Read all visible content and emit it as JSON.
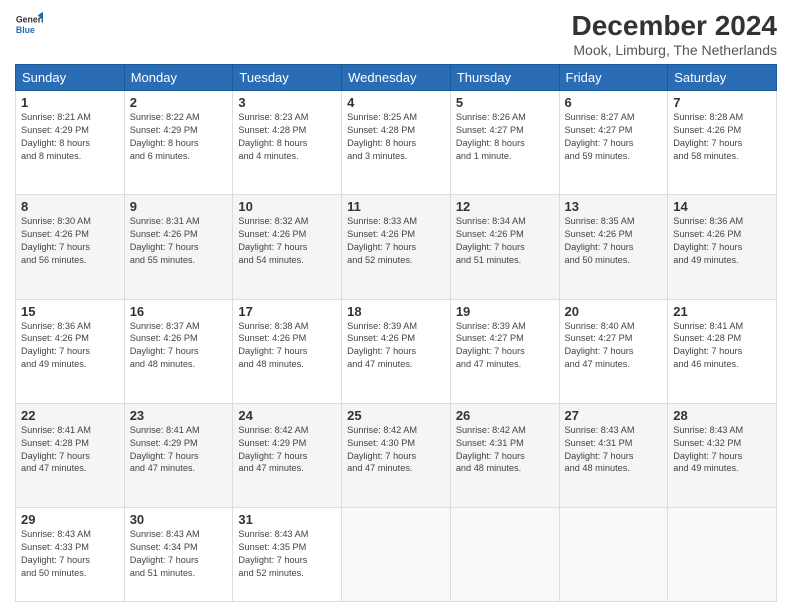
{
  "header": {
    "logo_line1": "General",
    "logo_line2": "Blue",
    "main_title": "December 2024",
    "subtitle": "Mook, Limburg, The Netherlands"
  },
  "days_of_week": [
    "Sunday",
    "Monday",
    "Tuesday",
    "Wednesday",
    "Thursday",
    "Friday",
    "Saturday"
  ],
  "weeks": [
    [
      {
        "day": "1",
        "text": "Sunrise: 8:21 AM\nSunset: 4:29 PM\nDaylight: 8 hours\nand 8 minutes."
      },
      {
        "day": "2",
        "text": "Sunrise: 8:22 AM\nSunset: 4:29 PM\nDaylight: 8 hours\nand 6 minutes."
      },
      {
        "day": "3",
        "text": "Sunrise: 8:23 AM\nSunset: 4:28 PM\nDaylight: 8 hours\nand 4 minutes."
      },
      {
        "day": "4",
        "text": "Sunrise: 8:25 AM\nSunset: 4:28 PM\nDaylight: 8 hours\nand 3 minutes."
      },
      {
        "day": "5",
        "text": "Sunrise: 8:26 AM\nSunset: 4:27 PM\nDaylight: 8 hours\nand 1 minute."
      },
      {
        "day": "6",
        "text": "Sunrise: 8:27 AM\nSunset: 4:27 PM\nDaylight: 7 hours\nand 59 minutes."
      },
      {
        "day": "7",
        "text": "Sunrise: 8:28 AM\nSunset: 4:26 PM\nDaylight: 7 hours\nand 58 minutes."
      }
    ],
    [
      {
        "day": "8",
        "text": "Sunrise: 8:30 AM\nSunset: 4:26 PM\nDaylight: 7 hours\nand 56 minutes."
      },
      {
        "day": "9",
        "text": "Sunrise: 8:31 AM\nSunset: 4:26 PM\nDaylight: 7 hours\nand 55 minutes."
      },
      {
        "day": "10",
        "text": "Sunrise: 8:32 AM\nSunset: 4:26 PM\nDaylight: 7 hours\nand 54 minutes."
      },
      {
        "day": "11",
        "text": "Sunrise: 8:33 AM\nSunset: 4:26 PM\nDaylight: 7 hours\nand 52 minutes."
      },
      {
        "day": "12",
        "text": "Sunrise: 8:34 AM\nSunset: 4:26 PM\nDaylight: 7 hours\nand 51 minutes."
      },
      {
        "day": "13",
        "text": "Sunrise: 8:35 AM\nSunset: 4:26 PM\nDaylight: 7 hours\nand 50 minutes."
      },
      {
        "day": "14",
        "text": "Sunrise: 8:36 AM\nSunset: 4:26 PM\nDaylight: 7 hours\nand 49 minutes."
      }
    ],
    [
      {
        "day": "15",
        "text": "Sunrise: 8:36 AM\nSunset: 4:26 PM\nDaylight: 7 hours\nand 49 minutes."
      },
      {
        "day": "16",
        "text": "Sunrise: 8:37 AM\nSunset: 4:26 PM\nDaylight: 7 hours\nand 48 minutes."
      },
      {
        "day": "17",
        "text": "Sunrise: 8:38 AM\nSunset: 4:26 PM\nDaylight: 7 hours\nand 48 minutes."
      },
      {
        "day": "18",
        "text": "Sunrise: 8:39 AM\nSunset: 4:26 PM\nDaylight: 7 hours\nand 47 minutes."
      },
      {
        "day": "19",
        "text": "Sunrise: 8:39 AM\nSunset: 4:27 PM\nDaylight: 7 hours\nand 47 minutes."
      },
      {
        "day": "20",
        "text": "Sunrise: 8:40 AM\nSunset: 4:27 PM\nDaylight: 7 hours\nand 47 minutes."
      },
      {
        "day": "21",
        "text": "Sunrise: 8:41 AM\nSunset: 4:28 PM\nDaylight: 7 hours\nand 46 minutes."
      }
    ],
    [
      {
        "day": "22",
        "text": "Sunrise: 8:41 AM\nSunset: 4:28 PM\nDaylight: 7 hours\nand 47 minutes."
      },
      {
        "day": "23",
        "text": "Sunrise: 8:41 AM\nSunset: 4:29 PM\nDaylight: 7 hours\nand 47 minutes."
      },
      {
        "day": "24",
        "text": "Sunrise: 8:42 AM\nSunset: 4:29 PM\nDaylight: 7 hours\nand 47 minutes."
      },
      {
        "day": "25",
        "text": "Sunrise: 8:42 AM\nSunset: 4:30 PM\nDaylight: 7 hours\nand 47 minutes."
      },
      {
        "day": "26",
        "text": "Sunrise: 8:42 AM\nSunset: 4:31 PM\nDaylight: 7 hours\nand 48 minutes."
      },
      {
        "day": "27",
        "text": "Sunrise: 8:43 AM\nSunset: 4:31 PM\nDaylight: 7 hours\nand 48 minutes."
      },
      {
        "day": "28",
        "text": "Sunrise: 8:43 AM\nSunset: 4:32 PM\nDaylight: 7 hours\nand 49 minutes."
      }
    ],
    [
      {
        "day": "29",
        "text": "Sunrise: 8:43 AM\nSunset: 4:33 PM\nDaylight: 7 hours\nand 50 minutes."
      },
      {
        "day": "30",
        "text": "Sunrise: 8:43 AM\nSunset: 4:34 PM\nDaylight: 7 hours\nand 51 minutes."
      },
      {
        "day": "31",
        "text": "Sunrise: 8:43 AM\nSunset: 4:35 PM\nDaylight: 7 hours\nand 52 minutes."
      },
      {
        "day": "",
        "text": ""
      },
      {
        "day": "",
        "text": ""
      },
      {
        "day": "",
        "text": ""
      },
      {
        "day": "",
        "text": ""
      }
    ]
  ]
}
